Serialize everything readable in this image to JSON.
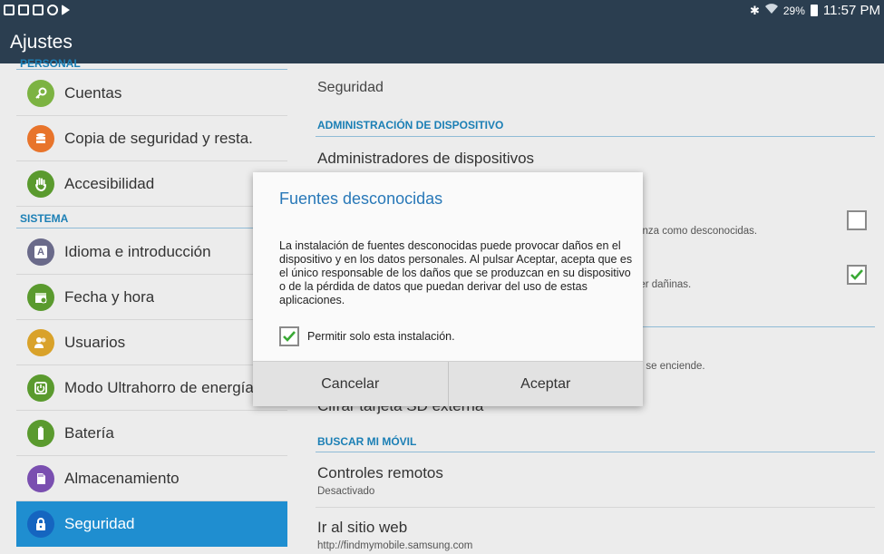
{
  "status_bar": {
    "battery": "29%",
    "clock": "11:57 PM"
  },
  "action_bar": {
    "title": "Ajustes"
  },
  "left": {
    "personal_header": "PERSONAL",
    "system_header": "SISTEMA",
    "items": [
      {
        "label": "Cuentas",
        "icon": "key-icon",
        "color": "#7cb342"
      },
      {
        "label": "Copia de seguridad y resta.",
        "icon": "backup-icon",
        "color": "#e8742b"
      },
      {
        "label": "Accesibilidad",
        "icon": "hand-icon",
        "color": "#5a9a2e"
      },
      {
        "label": "Idioma e introducción",
        "icon": "language-icon",
        "color": "#6a6a8a"
      },
      {
        "label": "Fecha y hora",
        "icon": "calendar-icon",
        "color": "#5a9a2e"
      },
      {
        "label": "Usuarios",
        "icon": "users-icon",
        "color": "#d9a22a"
      },
      {
        "label": "Modo Ultrahorro de energía",
        "icon": "power-saving-icon",
        "color": "#5a9a2e"
      },
      {
        "label": "Batería",
        "icon": "battery-icon",
        "color": "#5a9a2e"
      },
      {
        "label": "Almacenamiento",
        "icon": "storage-icon",
        "color": "#7a4fb0"
      },
      {
        "label": "Seguridad",
        "icon": "lock-icon",
        "color": "#1565c0",
        "selected": true
      }
    ]
  },
  "right": {
    "title": "Seguridad",
    "device_admin_header": "ADMINISTRACIÓN DE DISPOSITIVO",
    "device_admins_title": "Administradores de dispositivos",
    "unknown_sources_sub_visible": "nfianza como desconocidas.",
    "verify_apps_sub_visible": "n ser dañinas.",
    "encrypt_sub_visible": "que se enciende.",
    "encrypt_sd_title_visible": "Cifrar tarjeta SD externa",
    "find_mobile_header": "BUSCAR MI MÓVIL",
    "remote_controls_title": "Controles remotos",
    "remote_controls_sub": "Desactivado",
    "website_title": "Ir al sitio web",
    "website_sub": "http://findmymobile.samsung.com"
  },
  "dialog": {
    "title": "Fuentes desconocidas",
    "body": "La instalación de fuentes desconocidas puede provocar daños en el dispositivo y en los datos personales. Al pulsar Aceptar, acepta que es el único responsable de los daños que se produzcan en su dispositivo o de la pérdida de datos que puedan derivar del uso de estas aplicaciones.",
    "checkbox_label": "Permitir solo esta instalación.",
    "cancel_label": "Cancelar",
    "accept_label": "Aceptar"
  },
  "colors": {
    "bar": "#2b3e50",
    "accent": "#1b7fb5",
    "selected": "#1f8ed0",
    "check": "#3aa935"
  }
}
